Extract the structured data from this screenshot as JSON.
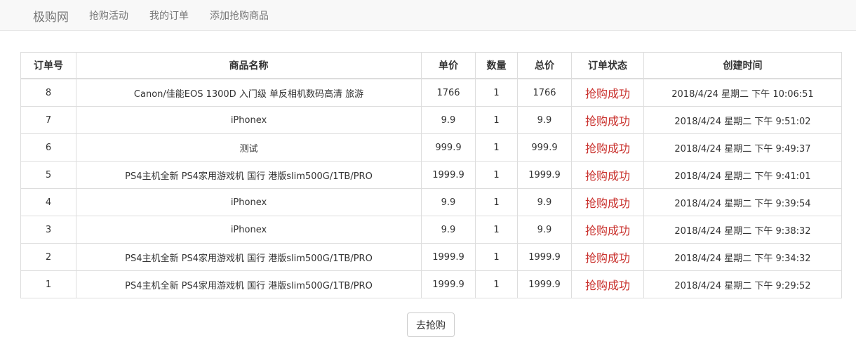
{
  "navbar": {
    "brand": "极购网",
    "links": [
      "抢购活动",
      "我的订单",
      "添加抢购商品"
    ]
  },
  "orders_table": {
    "headers": [
      "订单号",
      "商品名称",
      "单价",
      "数量",
      "总价",
      "订单状态",
      "创建时间"
    ],
    "rows": [
      {
        "id": "8",
        "name": "Canon/佳能EOS 1300D 入门级 单反相机数码高清 旅游",
        "price": "1766",
        "qty": "1",
        "total": "1766",
        "status": "抢购成功",
        "created": "2018/4/24 星期二 下午 10:06:51"
      },
      {
        "id": "7",
        "name": "iPhonex",
        "price": "9.9",
        "qty": "1",
        "total": "9.9",
        "status": "抢购成功",
        "created": "2018/4/24 星期二 下午 9:51:02"
      },
      {
        "id": "6",
        "name": "测试",
        "price": "999.9",
        "qty": "1",
        "total": "999.9",
        "status": "抢购成功",
        "created": "2018/4/24 星期二 下午 9:49:37"
      },
      {
        "id": "5",
        "name": "PS4主机全新 PS4家用游戏机 国行 港版slim500G/1TB/PRO",
        "price": "1999.9",
        "qty": "1",
        "total": "1999.9",
        "status": "抢购成功",
        "created": "2018/4/24 星期二 下午 9:41:01"
      },
      {
        "id": "4",
        "name": "iPhonex",
        "price": "9.9",
        "qty": "1",
        "total": "9.9",
        "status": "抢购成功",
        "created": "2018/4/24 星期二 下午 9:39:54"
      },
      {
        "id": "3",
        "name": "iPhonex",
        "price": "9.9",
        "qty": "1",
        "total": "9.9",
        "status": "抢购成功",
        "created": "2018/4/24 星期二 下午 9:38:32"
      },
      {
        "id": "2",
        "name": "PS4主机全新 PS4家用游戏机 国行 港版slim500G/1TB/PRO",
        "price": "1999.9",
        "qty": "1",
        "total": "1999.9",
        "status": "抢购成功",
        "created": "2018/4/24 星期二 下午 9:34:32"
      },
      {
        "id": "1",
        "name": "PS4主机全新 PS4家用游戏机 国行 港版slim500G/1TB/PRO",
        "price": "1999.9",
        "qty": "1",
        "total": "1999.9",
        "status": "抢购成功",
        "created": "2018/4/24 星期二 下午 9:29:52"
      }
    ]
  },
  "go_button_label": "去抢购",
  "colors": {
    "status": "#c9302c",
    "navbar_bg": "#f8f8f8",
    "nav_text": "#777777",
    "border": "#dddddd"
  }
}
